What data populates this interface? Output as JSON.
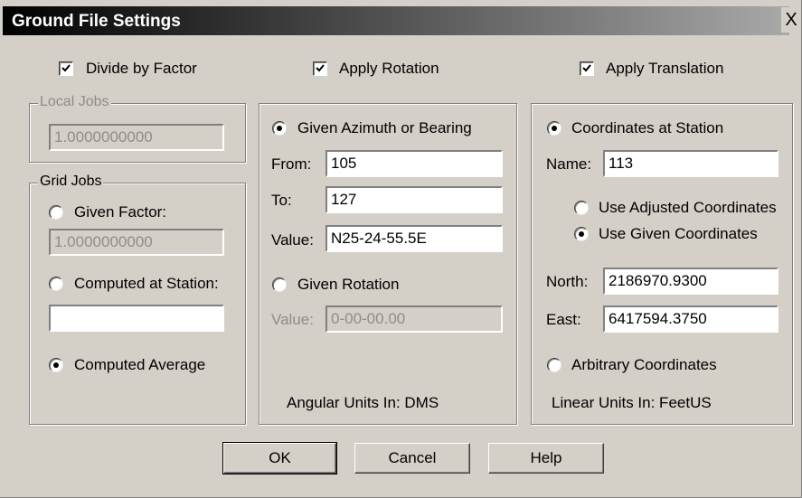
{
  "window": {
    "title": "Ground File Settings",
    "close_glyph": "X"
  },
  "top_checks": {
    "divide_by_factor": {
      "label": "Divide by Factor",
      "checked": true
    },
    "apply_rotation": {
      "label": "Apply Rotation",
      "checked": true
    },
    "apply_translation": {
      "label": "Apply Translation",
      "checked": true
    }
  },
  "local_jobs": {
    "title": "Local Jobs",
    "value": "1.0000000000"
  },
  "grid_jobs": {
    "title": "Grid Jobs",
    "given_factor": {
      "label": "Given Factor:",
      "value": "1.0000000000"
    },
    "computed_at_station": {
      "label": "Computed at Station:",
      "value": ""
    },
    "computed_average": {
      "label": "Computed Average"
    },
    "selected": "computed_average"
  },
  "rotation": {
    "given_azimuth": {
      "label": "Given Azimuth or Bearing"
    },
    "from": {
      "label": "From:",
      "value": "105"
    },
    "to": {
      "label": "To:",
      "value": "127"
    },
    "value": {
      "label": "Value:",
      "value": "N25-24-55.5E"
    },
    "given_rotation": {
      "label": "Given Rotation"
    },
    "rotation_value": {
      "label": "Value:",
      "value": "0-00-00.00"
    },
    "units": "Angular Units In: DMS",
    "selected": "given_azimuth"
  },
  "translation": {
    "coordinates_at_station": {
      "label": "Coordinates at Station"
    },
    "name": {
      "label": "Name:",
      "value": "113"
    },
    "use_adjusted": {
      "label": "Use Adjusted Coordinates"
    },
    "use_given": {
      "label": "Use Given Coordinates"
    },
    "north": {
      "label": "North:",
      "value": "2186970.9300"
    },
    "east": {
      "label": "East:",
      "value": "6417594.3750"
    },
    "arbitrary": {
      "label": "Arbitrary Coordinates"
    },
    "units": "Linear Units In: FeetUS",
    "selected": "coordinates_at_station",
    "coord_source": "use_given"
  },
  "buttons": {
    "ok": "OK",
    "cancel": "Cancel",
    "help": "Help"
  }
}
